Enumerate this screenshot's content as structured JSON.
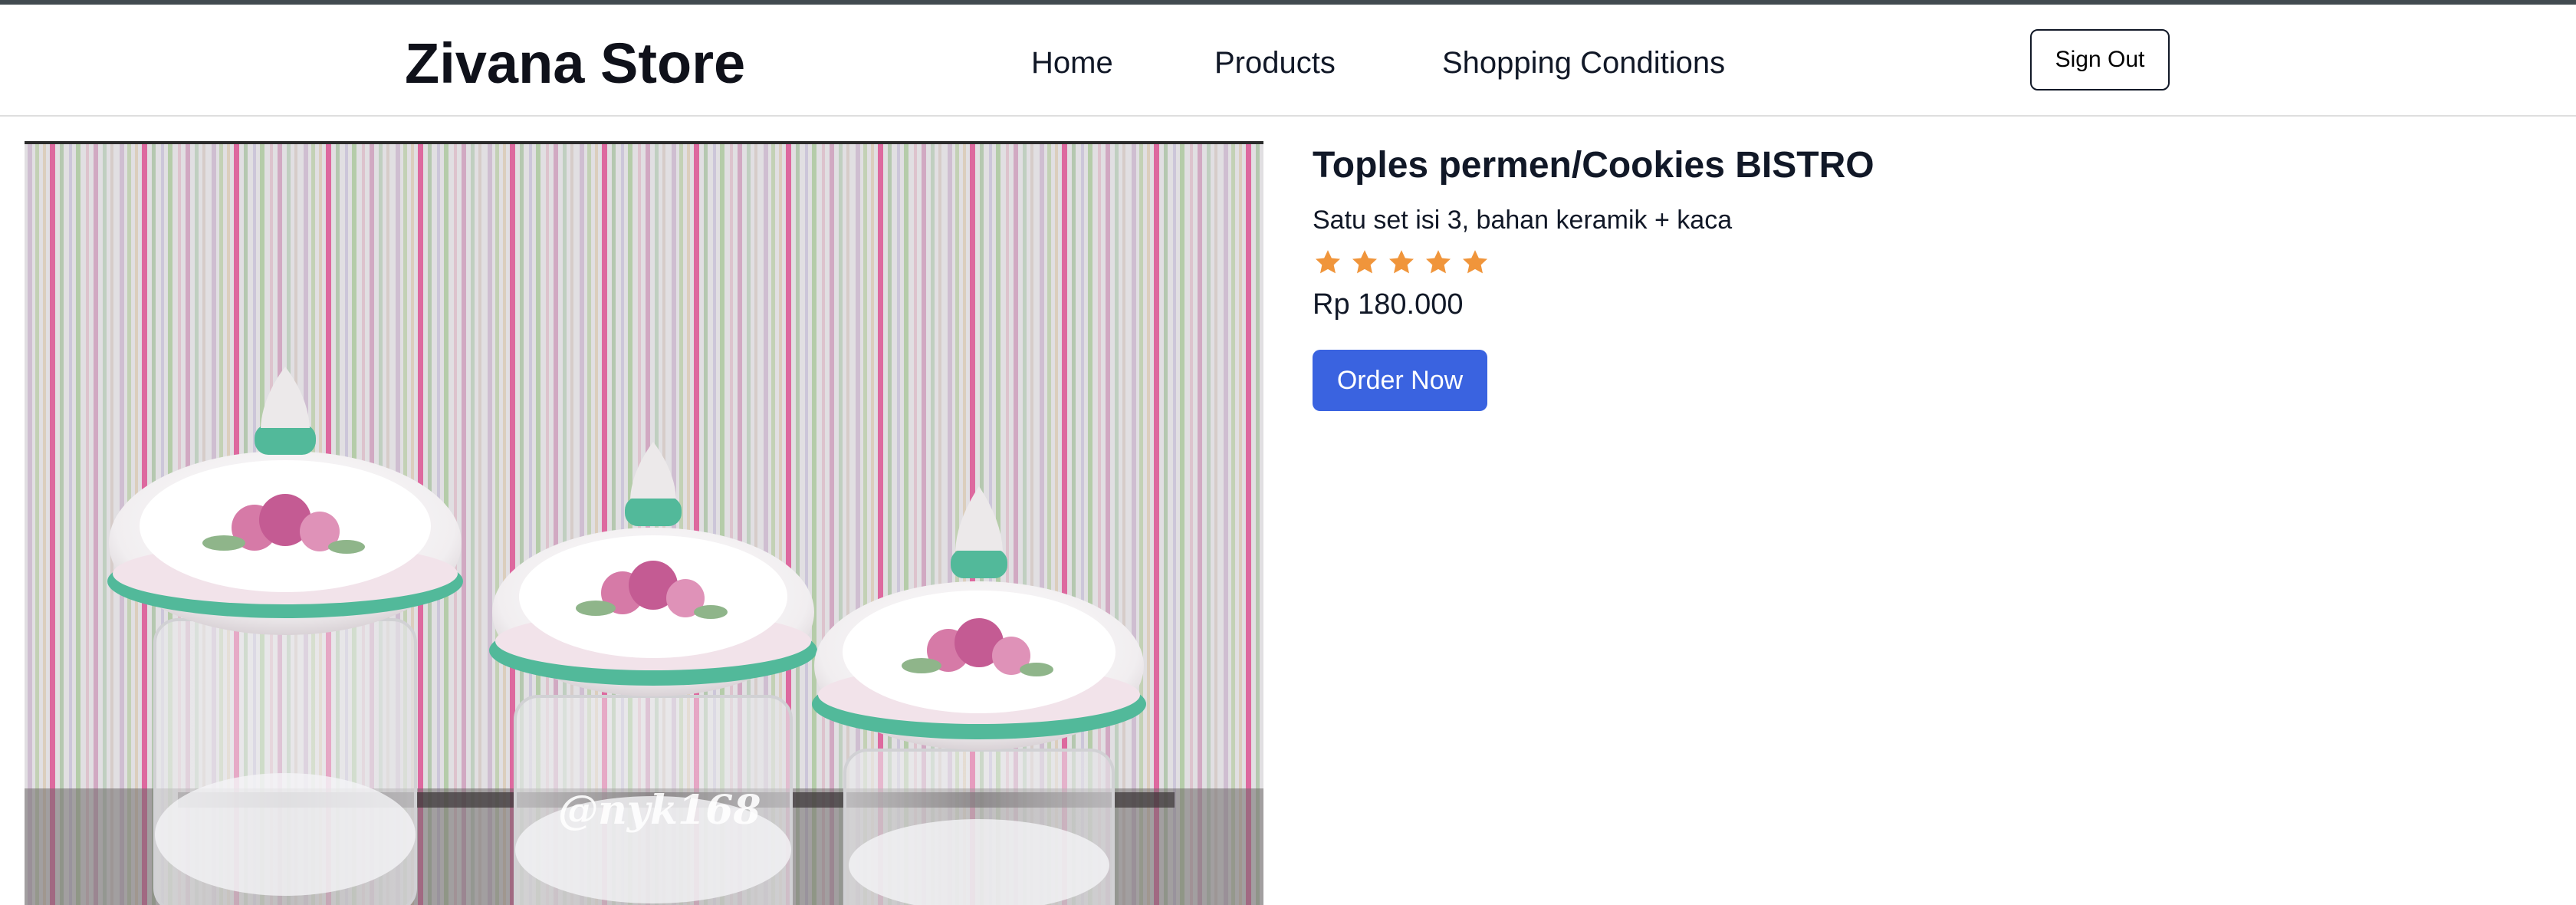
{
  "header": {
    "brand": "Zivana Store",
    "nav": {
      "home": "Home",
      "products": "Products",
      "conditions": "Shopping Conditions"
    },
    "sign_out": "Sign Out"
  },
  "product": {
    "title": "Toples permen/Cookies BISTRO",
    "description": "Satu set isi 3, bahan keramik + kaca",
    "rating": 5,
    "rating_max": 5,
    "price": "Rp 180.000",
    "order_label": "Order Now",
    "image_watermark": "@nyk168"
  },
  "colors": {
    "accent": "#3a63e0",
    "star": "#f0953b",
    "top_strip": "#424b50"
  }
}
